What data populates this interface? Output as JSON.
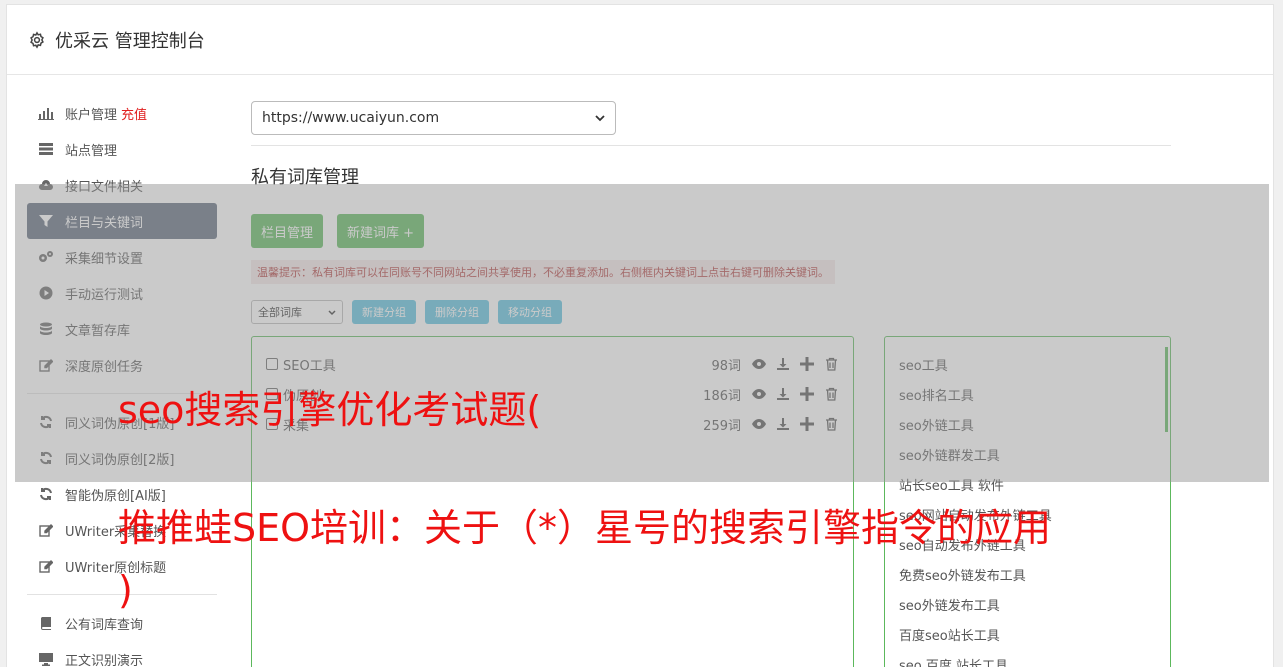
{
  "header": {
    "title": "优采云 管理控制台",
    "icon": "gear-icon"
  },
  "sidebar": {
    "items": [
      {
        "label": "账户管理",
        "badge": "充值",
        "icon": "bar-chart-icon"
      },
      {
        "label": "站点管理",
        "icon": "server-icon"
      },
      {
        "label": "接口文件相关",
        "icon": "cloud-upload-icon"
      },
      {
        "label": "栏目与关键词",
        "icon": "filter-icon",
        "active": true
      },
      {
        "label": "采集细节设置",
        "icon": "gears-icon"
      },
      {
        "label": "手动运行测试",
        "icon": "play-circle-icon"
      },
      {
        "label": "文章暂存库",
        "icon": "database-icon"
      },
      {
        "label": "深度原创任务",
        "icon": "edit-icon"
      },
      {
        "label": "同义词伪原创[1版]",
        "icon": "refresh-icon"
      },
      {
        "label": "同义词伪原创[2版]",
        "icon": "refresh-icon"
      },
      {
        "label": "智能伪原创[AI版]",
        "icon": "refresh-icon"
      },
      {
        "label": "UWriter采集替换",
        "icon": "edit-icon"
      },
      {
        "label": "UWriter原创标题",
        "icon": "edit-icon"
      },
      {
        "label": "公有词库查询",
        "icon": "book-icon"
      },
      {
        "label": "正文识别演示",
        "icon": "monitor-icon"
      }
    ]
  },
  "main": {
    "site_select": "https://www.ucaiyun.com",
    "section_title": "私有词库管理",
    "buttons": {
      "column_manage": "栏目管理",
      "new_library": "新建词库 +"
    },
    "tip": "温馨提示：私有词库可以在同账号不同网站之间共享使用，不必重复添加。右侧框内关键词上点击右键可删除关键词。",
    "group_select": "全部词库",
    "group_buttons": {
      "new_group": "新建分组",
      "delete_group": "删除分组",
      "move_group": "移动分组"
    },
    "libraries": [
      {
        "name": "SEO工具",
        "count": "98词"
      },
      {
        "name": "伪原创",
        "count": "186词"
      },
      {
        "name": "采集",
        "count": "259词"
      }
    ],
    "keywords": [
      "seo工具",
      "seo排名工具",
      "seo外链工具",
      "seo外链群发工具",
      "站长seo工具 软件",
      "seo网站自动发布外链工具",
      "seo自动发布外链工具",
      "免费seo外链发布工具",
      "seo外链发布工具",
      "百度seo站长工具",
      "seo 百度 站长工具"
    ]
  },
  "overlay": {
    "line1": "seo搜索引擎优化考试题(",
    "line2": "推推蛙SEO培训：关于（*）星号的搜索引擎指令的应用",
    "line3": ")"
  },
  "colors": {
    "accent_green": "#5cb85c",
    "accent_blue": "#5bc0de",
    "active_nav": "#5e6b7d",
    "overlay_text": "#ee1111"
  }
}
